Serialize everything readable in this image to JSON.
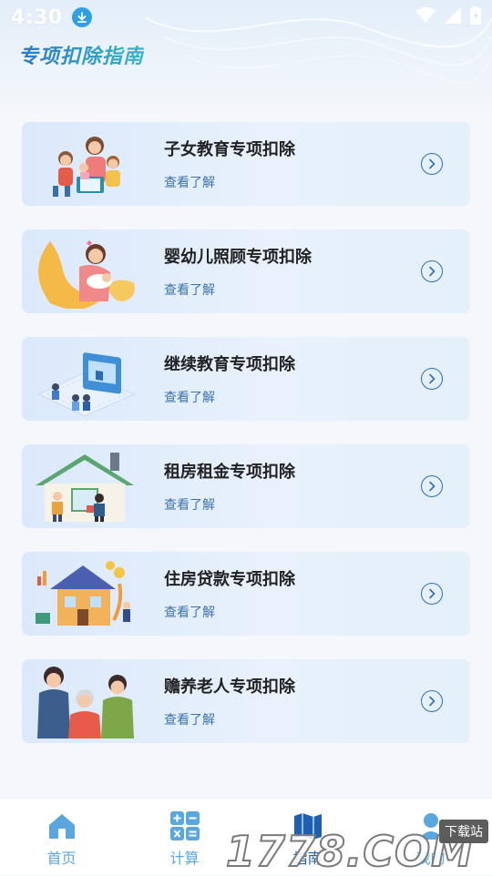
{
  "status_bar": {
    "time": "4:30"
  },
  "page": {
    "title": "专项扣除指南"
  },
  "cards": [
    {
      "title": "子女教育专项扣除",
      "link": "查看了解",
      "illustration": "family-reading-illustration"
    },
    {
      "title": "婴幼儿照顾专项扣除",
      "link": "查看了解",
      "illustration": "mother-baby-illustration"
    },
    {
      "title": "继续教育专项扣除",
      "link": "查看了解",
      "illustration": "online-learning-illustration"
    },
    {
      "title": "租房租金专项扣除",
      "link": "查看了解",
      "illustration": "house-rental-illustration"
    },
    {
      "title": "住房贷款专项扣除",
      "link": "查看了解",
      "illustration": "housing-loan-illustration"
    },
    {
      "title": "赡养老人专项扣除",
      "link": "查看了解",
      "illustration": "elderly-care-illustration"
    }
  ],
  "tabs": [
    {
      "label": "首页",
      "icon": "home-icon"
    },
    {
      "label": "计算",
      "icon": "calculator-icon"
    },
    {
      "label": "指南",
      "icon": "guide-icon",
      "active": true
    },
    {
      "label": "我的",
      "icon": "profile-icon"
    }
  ],
  "watermark": {
    "number": "1778.COM",
    "tag": "下载站"
  },
  "colors": {
    "accent": "#1f5fb0",
    "tab_inactive": "#5aa7e0",
    "link": "#3b73b0",
    "card_bg": "#dbe9fb"
  }
}
